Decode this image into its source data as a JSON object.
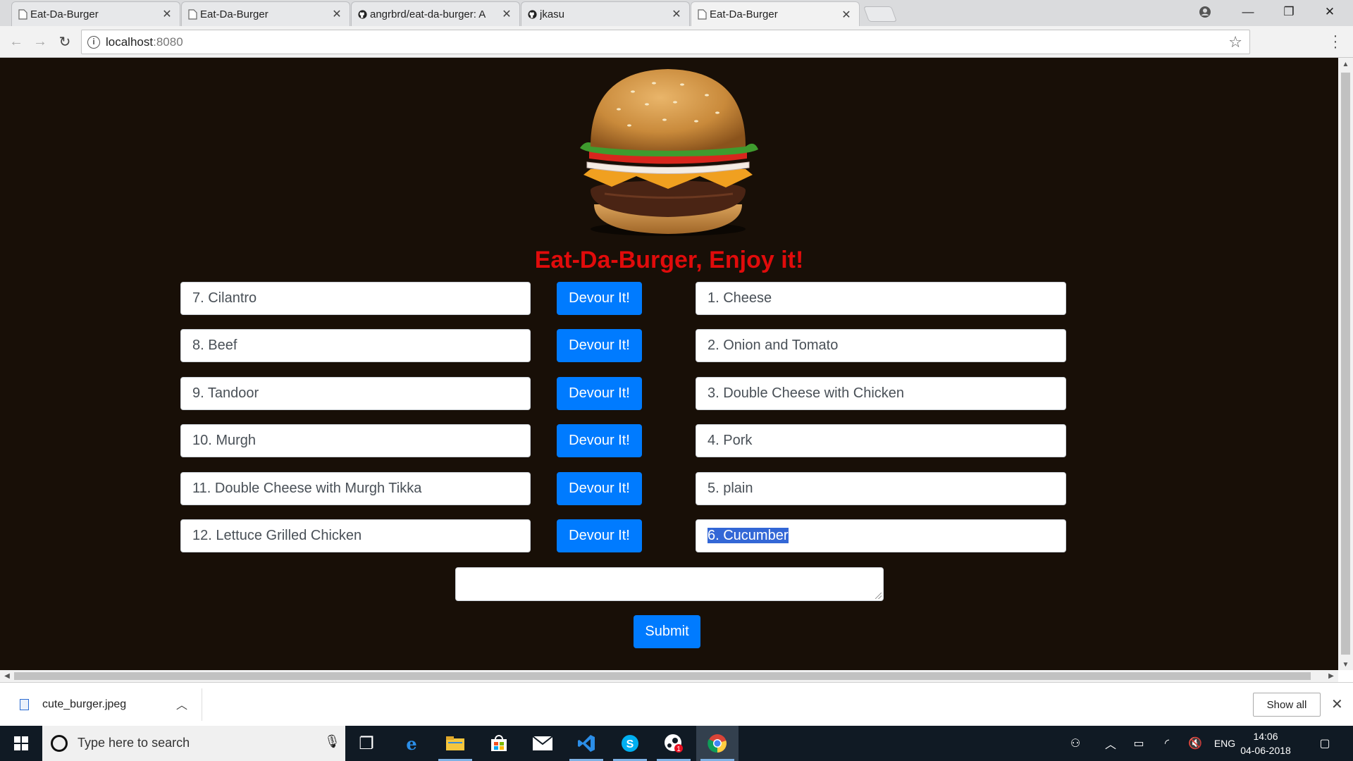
{
  "browser": {
    "tabs": [
      {
        "label": "Eat-Da-Burger",
        "icon": "page-icon"
      },
      {
        "label": "Eat-Da-Burger",
        "icon": "page-icon"
      },
      {
        "label": "angrbrd/eat-da-burger: A",
        "icon": "github-icon"
      },
      {
        "label": "jkasu",
        "icon": "github-icon"
      },
      {
        "label": "Eat-Da-Burger",
        "icon": "page-icon",
        "active": true
      }
    ],
    "url_host": "localhost",
    "url_port": ":8080"
  },
  "page": {
    "title": "Eat-Da-Burger, Enjoy it!",
    "colors": {
      "background": "#180f07",
      "title": "#e00b0b",
      "button": "#007bff"
    },
    "rows": [
      {
        "left": "7. Cilantro",
        "button": "Devour It!",
        "right": "1. Cheese"
      },
      {
        "left": "8. Beef",
        "button": "Devour It!",
        "right": "2. Onion and Tomato"
      },
      {
        "left": "9. Tandoor",
        "button": "Devour It!",
        "right": "3. Double Cheese with Chicken"
      },
      {
        "left": "10. Murgh",
        "button": "Devour It!",
        "right": "4. Pork"
      },
      {
        "left": "11. Double Cheese with Murgh Tikka",
        "button": "Devour It!",
        "right": "5. plain"
      },
      {
        "left": "12. Lettuce Grilled Chicken",
        "button": "Devour It!",
        "right": "6. Cucumber"
      }
    ],
    "new_burger_value": "",
    "submit_label": "Submit"
  },
  "downloads": {
    "file_name": "cute_burger.jpeg",
    "show_all": "Show all"
  },
  "taskbar": {
    "search_placeholder": "Type here to search",
    "language": "ENG",
    "time": "14:06",
    "date": "04-06-2018",
    "badge_count": "1"
  }
}
